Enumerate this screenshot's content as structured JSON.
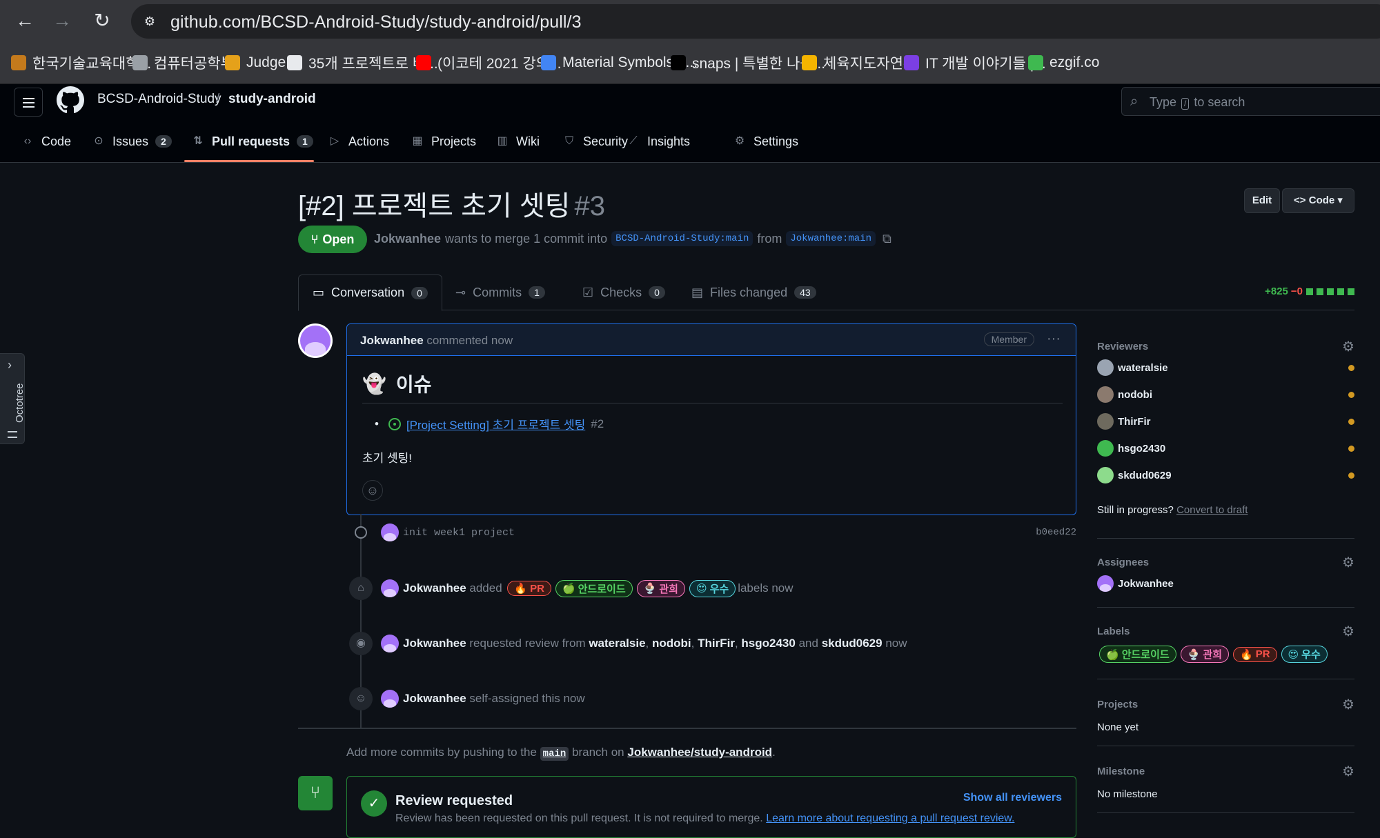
{
  "browser": {
    "url": "github.com/BCSD-Android-Study/study-android/pull/3",
    "bookmarks": [
      {
        "label": "한국기술교육대학...",
        "color": "#c47a1c"
      },
      {
        "label": "컴퓨터공학부",
        "color": "#9aa0a6"
      },
      {
        "label": "Judge",
        "color": "#e5a11a"
      },
      {
        "label": "35개 프로젝트로 배...",
        "color": "#e8eaed"
      },
      {
        "label": "(이코테 2021 강의...",
        "color": "#ff0000"
      },
      {
        "label": "Material Symbols a...",
        "color": "#4285f4"
      },
      {
        "label": "snaps | 특별한 나를...",
        "color": "#000000"
      },
      {
        "label": "체육지도자연수",
        "color": "#f4b400"
      },
      {
        "label": "IT 개발 이야기들 |...",
        "color": "#7b3fe4"
      },
      {
        "label": "ezgif.co",
        "color": "#3fb950"
      }
    ]
  },
  "header": {
    "owner": "BCSD-Android-Study",
    "separator": "/",
    "repo": "study-android",
    "search_placeholder_pre": "Type",
    "search_key": "/",
    "search_placeholder_post": "to search"
  },
  "repo_tabs": [
    {
      "label": "Code",
      "icon": "code-icon",
      "count": null
    },
    {
      "label": "Issues",
      "icon": "issue-icon",
      "count": "2"
    },
    {
      "label": "Pull requests",
      "icon": "pull-request-icon",
      "count": "1"
    },
    {
      "label": "Actions",
      "icon": "play-icon"
    },
    {
      "label": "Projects",
      "icon": "table-icon"
    },
    {
      "label": "Wiki",
      "icon": "book-icon"
    },
    {
      "label": "Security",
      "icon": "shield-icon"
    },
    {
      "label": "Insights",
      "icon": "graph-icon"
    },
    {
      "label": "Settings",
      "icon": "gear-icon"
    }
  ],
  "octotree": {
    "label": "Octotree"
  },
  "pr": {
    "title": "[#2] 프로젝트 초기 셋팅",
    "number": "#3",
    "edit_label": "Edit",
    "code_label": "Code",
    "state": "Open",
    "author": "Jokwanhee",
    "meta_text_1": "wants to merge 1 commit into",
    "base_branch": "BCSD-Android-Study:main",
    "meta_text_2": "from",
    "head_branch": "Jokwanhee:main"
  },
  "pr_tabs": [
    {
      "label": "Conversation",
      "count": "0",
      "icon": "comment-discussion-icon"
    },
    {
      "label": "Commits",
      "count": "1",
      "icon": "commit-icon"
    },
    {
      "label": "Checks",
      "count": "0",
      "icon": "checklist-icon"
    },
    {
      "label": "Files changed",
      "count": "43",
      "icon": "file-diff-icon"
    }
  ],
  "diffstat": {
    "additions": "+825",
    "deletions": "−0",
    "blocks": 5
  },
  "comment": {
    "author": "Jokwanhee",
    "time": "commented now",
    "badge": "Member",
    "more": "···",
    "heading_emoji": "👻",
    "heading": "이슈",
    "issue_link": "[Project Setting] 초기 프로젝트 셋팅",
    "issue_number": "#2",
    "body": "초기 셋팅!"
  },
  "timeline": {
    "commit": {
      "message": "init week1 project",
      "sha": "b0eed22"
    },
    "labels_event": {
      "actor": "Jokwanhee",
      "verb": "added",
      "suffix": "labels now"
    },
    "review_event": {
      "actor": "Jokwanhee",
      "verb": "requested review from",
      "r1": "wateralsie",
      "r2": "nodobi",
      "r3": "ThirFir",
      "r4": "hsgo2430",
      "and": "and",
      "r5": "skdud0629",
      "suffix": "now"
    },
    "assign_event": {
      "actor": "Jokwanhee",
      "text": "self-assigned this now"
    }
  },
  "labels": [
    {
      "emoji": "🔥",
      "name": "PR",
      "color": "#f85149",
      "bg": "#3d1a16"
    },
    {
      "emoji": "🍏",
      "name": "안드로이드",
      "color": "#56d364",
      "bg": "#0f2f16"
    },
    {
      "emoji": "🍨",
      "name": "관희",
      "color": "#f778ba",
      "bg": "#3a1730"
    },
    {
      "emoji": "😍",
      "name": "우수",
      "color": "#56d4dd",
      "bg": "#0c2d33"
    }
  ],
  "push_hint": {
    "pre": "Add more commits by pushing to the",
    "branch": "main",
    "mid": "branch on",
    "repo": "Jokwanhee/study-android",
    "post": "."
  },
  "review_box": {
    "title": "Review requested",
    "desc": "Review has been requested on this pull request. It is not required to merge.",
    "link": "Learn more about requesting a pull request review.",
    "show_all": "Show all reviewers"
  },
  "sidebar": {
    "reviewers_title": "Reviewers",
    "reviewers": [
      {
        "name": "wateralsie",
        "color": "#9aa4b2"
      },
      {
        "name": "nodobi",
        "color": "#8b7a6e"
      },
      {
        "name": "ThirFir",
        "color": "#6e6a5e"
      },
      {
        "name": "hsgo2430",
        "color": "#3fb950"
      },
      {
        "name": "skdud0629",
        "color": "#8ddb8c"
      }
    ],
    "draft_text": "Still in progress?",
    "draft_link": "Convert to draft",
    "assignees_title": "Assignees",
    "assignee": "Jokwanhee",
    "labels_title": "Labels",
    "projects_title": "Projects",
    "projects_value": "None yet",
    "milestone_title": "Milestone",
    "milestone_value": "No milestone"
  }
}
